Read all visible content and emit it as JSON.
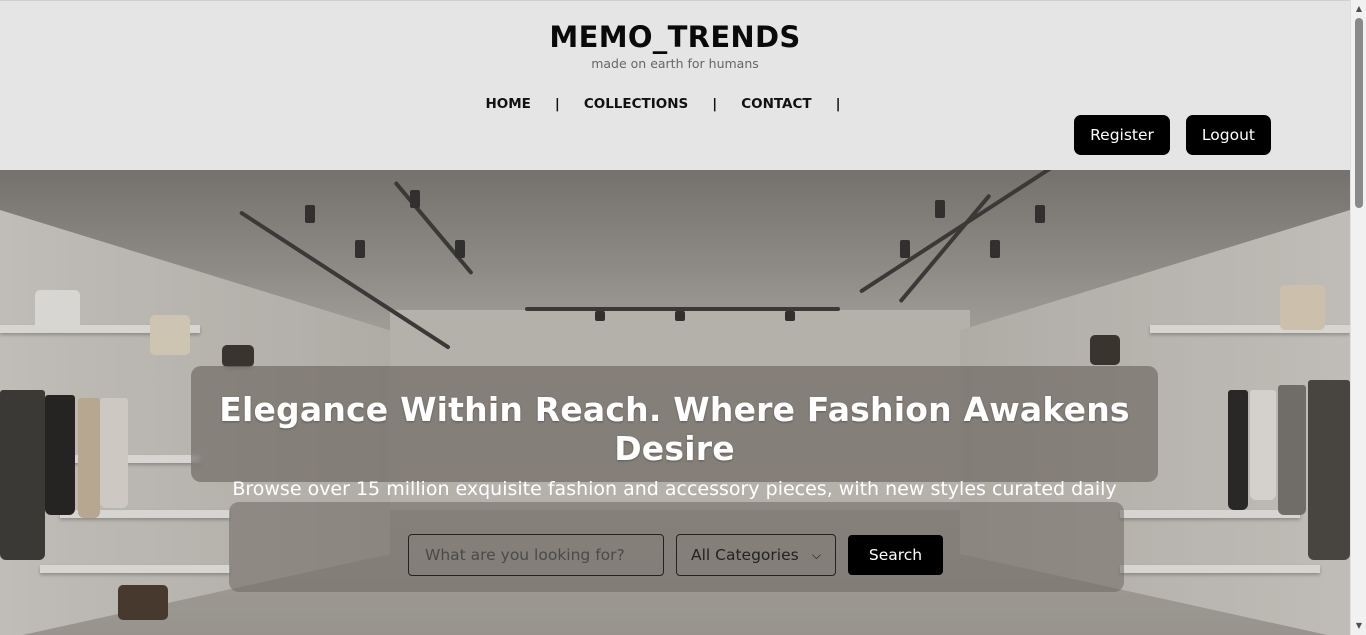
{
  "header": {
    "brand_title": "MEMO_TRENDS",
    "tagline": "made on earth for humans",
    "nav": [
      {
        "label": "HOME"
      },
      {
        "label": "COLLECTIONS"
      },
      {
        "label": "CONTACT"
      }
    ],
    "separator": "|",
    "register_label": "Register",
    "logout_label": "Logout"
  },
  "hero": {
    "headline": "Elegance Within Reach. Where Fashion Awakens Desire",
    "subheadline": "Browse over 15 million exquisite fashion and accessory pieces, with new styles curated daily",
    "search": {
      "placeholder": "What are you looking for?",
      "value": "",
      "category_selected": "All Categories",
      "button_label": "Search"
    }
  },
  "icons": {
    "dropdown": "chevron-down-icon",
    "scroll_up": "triangle-up-icon",
    "scroll_down": "triangle-down-icon"
  },
  "colors": {
    "header_bg": "#e5e5e5",
    "button_bg": "#000000",
    "button_text": "#ffffff"
  }
}
